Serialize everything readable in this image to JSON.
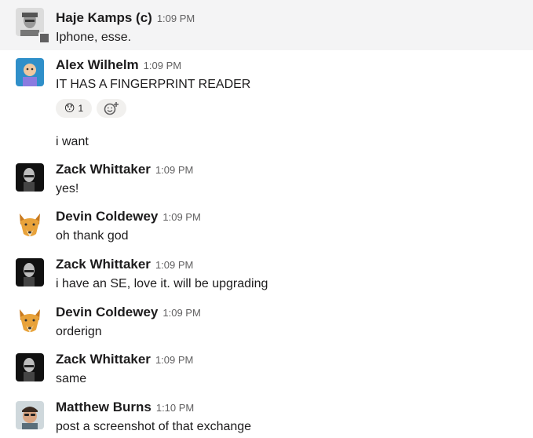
{
  "messages": [
    {
      "author": "Haje Kamps (c)",
      "time": "1:09 PM",
      "text": "Iphone, esse."
    },
    {
      "author": "Alex Wilhelm",
      "time": "1:09 PM",
      "text": "IT HAS A FINGERPRINT READER",
      "reaction": {
        "emoji": "😯",
        "count": "1"
      }
    },
    {
      "text": "i want"
    },
    {
      "author": "Zack Whittaker",
      "time": "1:09 PM",
      "text": "yes!"
    },
    {
      "author": "Devin Coldewey",
      "time": "1:09 PM",
      "text": "oh thank god"
    },
    {
      "author": "Zack Whittaker",
      "time": "1:09 PM",
      "text": "i have an SE, love it. will be upgrading"
    },
    {
      "author": "Devin Coldewey",
      "time": "1:09 PM",
      "text": "orderign"
    },
    {
      "author": "Zack Whittaker",
      "time": "1:09 PM",
      "text": "same"
    },
    {
      "author": "Matthew Burns",
      "time": "1:10 PM",
      "text": "post a screenshot of that exchange"
    }
  ],
  "colors": {
    "highlight": "#f4f4f5",
    "presence": "#616061",
    "reaction_bg": "#f1f0ee"
  }
}
